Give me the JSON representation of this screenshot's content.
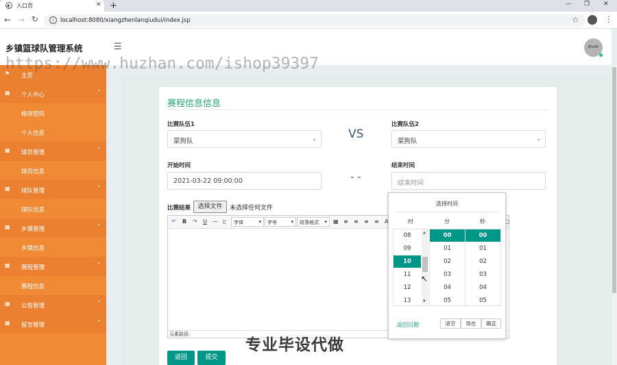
{
  "browser": {
    "tab_title": "入口页",
    "url": "localhost:8080/xiangzhenlanqiudui/index.jsp"
  },
  "header": {
    "title": "乡镇篮球队管理系统",
    "avatar_text": "80x80",
    "watermark": "https://www.huzhan.com/ishop39397"
  },
  "sidebar": {
    "items": [
      {
        "label": "主页",
        "icon": "flag-icon",
        "type": "parent"
      },
      {
        "label": "个人中心",
        "icon": "grid-icon",
        "type": "parent"
      },
      {
        "label": "修改密码",
        "type": "child"
      },
      {
        "label": "个人信息",
        "type": "child"
      },
      {
        "label": "球员管理",
        "icon": "grid-icon",
        "type": "parent"
      },
      {
        "label": "球员信息",
        "type": "child"
      },
      {
        "label": "球队管理",
        "icon": "grid-icon",
        "type": "parent"
      },
      {
        "label": "球队信息",
        "type": "child"
      },
      {
        "label": "乡镇管理",
        "icon": "grid-icon",
        "type": "parent"
      },
      {
        "label": "乡镇信息",
        "type": "child"
      },
      {
        "label": "赛程管理",
        "icon": "grid-icon",
        "type": "parent"
      },
      {
        "label": "赛程信息",
        "type": "child"
      },
      {
        "label": "公告管理",
        "icon": "grid-icon",
        "type": "parent"
      },
      {
        "label": "留言管理",
        "icon": "grid-icon",
        "type": "parent"
      }
    ]
  },
  "form": {
    "title": "赛程信息信息",
    "team1_label": "比赛队伍1",
    "team1_value": "菜狗队",
    "vs": "VS",
    "team2_label": "比赛队伍2",
    "team2_value": "菜狗队",
    "start_label": "开始时间",
    "start_value": "2021-03-22 09:00:00",
    "dash": "- -",
    "end_label": "结束时间",
    "end_placeholder": "结束时间",
    "result_label": "比赛结果",
    "file_button": "选择文件",
    "file_status": "未选择任何文件",
    "editor_path": "元素路径:"
  },
  "editor_toolbar": {
    "font": "字体",
    "size": "字号",
    "format": "段落格式"
  },
  "picker": {
    "title": "选择时间",
    "col_hour": "时",
    "col_min": "分",
    "col_sec": "秒",
    "hours": [
      "08",
      "09",
      "10",
      "11",
      "12",
      "13"
    ],
    "minutes": [
      "00",
      "01",
      "02",
      "03",
      "04",
      "05"
    ],
    "seconds": [
      "00",
      "01",
      "02",
      "03",
      "04",
      "05"
    ],
    "selected_hour": "10",
    "selected_minute": "00",
    "selected_second": "00",
    "back_link": "返回日期",
    "clear": "清空",
    "now": "现在",
    "confirm": "确定"
  },
  "buttons": {
    "back": "返回",
    "submit": "提交"
  },
  "overlay_text": "专业毕设代做",
  "colors": {
    "sidebar": "#f08a35",
    "accent": "#009688",
    "title_green": "#27a37c"
  }
}
